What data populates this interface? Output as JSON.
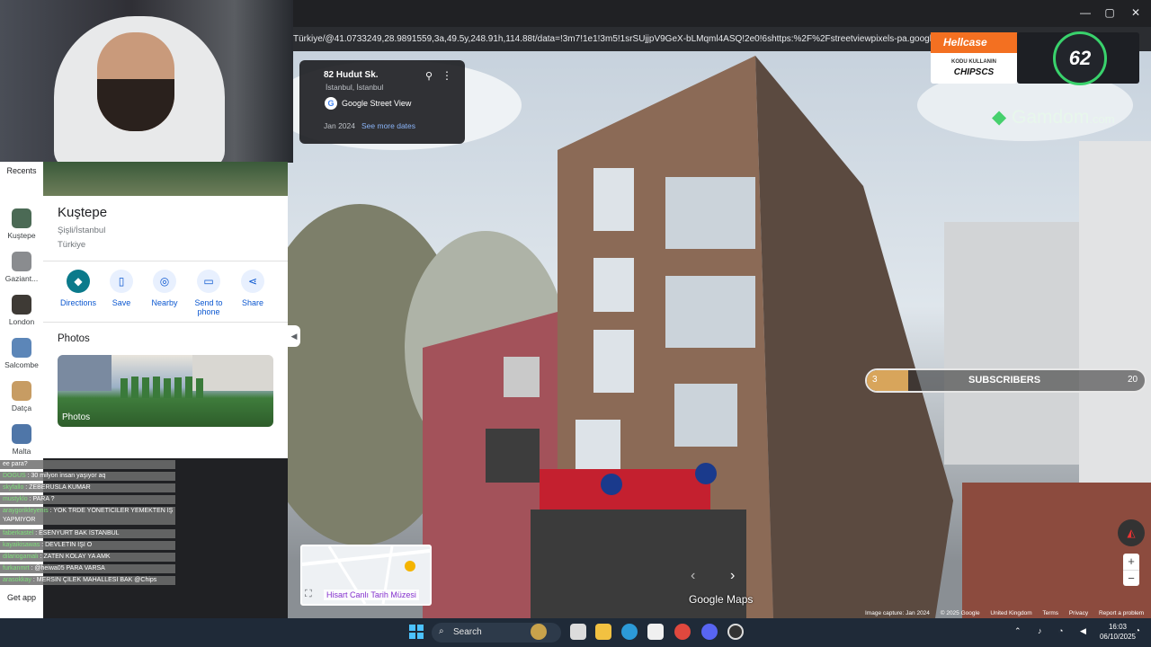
{
  "browser": {
    "url": "Türkiye/@41.0733249,28.9891559,3a,49.5y,248.91h,114.88t/data=!3m7!1e1!3m5!1srSUjjpV9GeX-bLMqml4ASQ!2e0!6shttps:%2F%2Fstreetviewpixels-pa.googleapis.com%2Fv1",
    "minimize": "—",
    "restore": "▢",
    "close": "✕"
  },
  "sidebar": {
    "recents_label": "Recents",
    "items": [
      {
        "label": "Kuştepe"
      },
      {
        "label": "Gaziant..."
      },
      {
        "label": "London"
      },
      {
        "label": "Salcombe"
      },
      {
        "label": "Datça"
      },
      {
        "label": "Malta"
      }
    ],
    "get_app": "Get app"
  },
  "place": {
    "title": "Kuştepe",
    "district": "Şişli/İstanbul",
    "country": "Türkiye",
    "actions": [
      {
        "label": "Directions",
        "icon": "directions-icon"
      },
      {
        "label": "Save",
        "icon": "bookmark-icon"
      },
      {
        "label": "Nearby",
        "icon": "nearby-icon"
      },
      {
        "label": "Send to phone",
        "icon": "phone-icon"
      },
      {
        "label": "Share",
        "icon": "share-icon"
      }
    ],
    "photos_heading": "Photos",
    "photos_label": "Photos"
  },
  "streetview": {
    "address": "82 Hudut Sk.",
    "city": "İstanbul, İstanbul",
    "source": "Google Street View",
    "date": "Jan 2024",
    "see_more": "See more dates",
    "minimap_place": "Hisart Canlı Tarih Müzesi",
    "watermark": "Google Maps",
    "footer": [
      "Image capture: Jan 2024",
      "© 2025 Google",
      "United Kingdom",
      "Terms",
      "Privacy",
      "Report a problem"
    ]
  },
  "overlay": {
    "hellcase_brand": "Hellcase",
    "hellcase_line1": "KODU KULLANIN",
    "hellcase_code": "CHIPSCS",
    "gauge_value": "62",
    "gamdom_brand": "Gamdom",
    "gamdom_tld": ".com",
    "sub_current": "3",
    "sub_label": "SUBSCRIBERS",
    "sub_goal": "20",
    "sub_progress": 0.15
  },
  "chat": [
    {
      "user": "",
      "msg": "ee para?"
    },
    {
      "user": "DOGUS",
      "msg": "30 milyon insan yaşıyor aq"
    },
    {
      "user": "skyfallo",
      "msg": "ZEBERUSLA KUMAR"
    },
    {
      "user": "mustyklo",
      "msg": "PARA ?"
    },
    {
      "user": "araygorikleyenis",
      "msg": "YOK TRDE YÖNETİCİLER YEMEKTEN İŞ YAPMIYOR"
    },
    {
      "user": "faberkastel",
      "msg": "ESENYURT BAK İSTANBUL"
    },
    {
      "user": "kayaikisawas",
      "msg": "DEVLETİN İŞİ O"
    },
    {
      "user": "dilariogamalı",
      "msg": "ZATEN KOLAY YA AMK"
    },
    {
      "user": "furkanmrt",
      "msg": "@heiwa05 PARA VARSA"
    },
    {
      "user": "arasokkay",
      "msg": "MERSİN ÇİLEK MAHALLESİ BAK @Chips"
    }
  ],
  "taskbar": {
    "search": "Search",
    "time": "16:03",
    "date": "06/10/2025"
  }
}
